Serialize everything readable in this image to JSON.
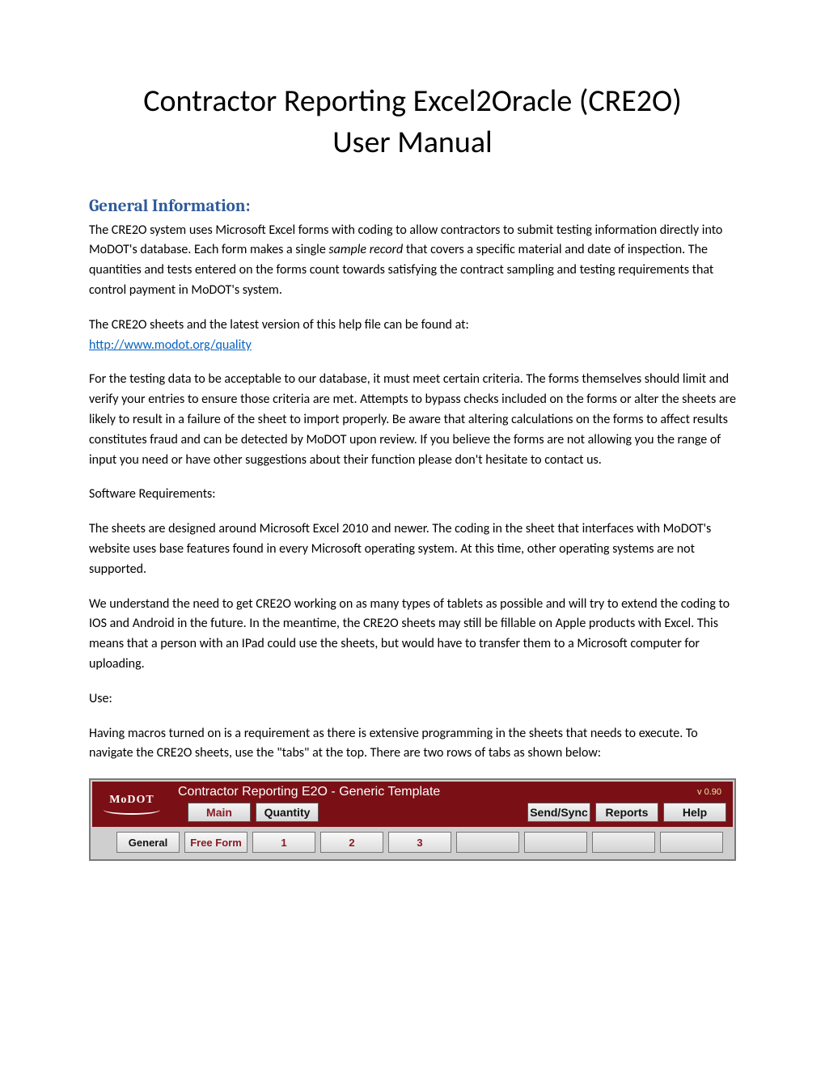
{
  "title_line1": "Contractor Reporting Excel2Oracle  (CRE2O)",
  "title_line2": "User Manual",
  "section_heading": "General Information:",
  "para1a": "The CRE2O system uses Microsoft Excel forms with coding to allow contractors to submit testing information directly into MoDOT's database.   Each form makes a single ",
  "para1_italic": "sample record",
  "para1b": " that covers a specific material and date of inspection.  The quantities and tests entered on the forms count towards satisfying the contract sampling and testing requirements that control payment in MoDOT's system.",
  "para2_intro": "The CRE2O sheets and the latest version of this help file can be found at:",
  "link_url": "http://www.modot.org/quality",
  "para3": "For the testing data to be acceptable to our database, it must meet certain criteria.  The forms themselves should limit and verify your entries to ensure those criteria are met.   Attempts to bypass checks included on the forms or alter the sheets are likely to result in a failure of the sheet to import properly.   Be aware that altering calculations on the forms to affect results constitutes fraud and can be detected by MoDOT upon review.  If you believe the forms are not allowing you the range of input you need or have other suggestions about their function please don't hesitate to contact us.",
  "para4": "Software Requirements:",
  "para5": "The sheets are designed around Microsoft Excel 2010 and newer.   The coding in the sheet that interfaces with MoDOT's website uses base features found in every Microsoft operating system.   At this time, other operating systems are not supported.",
  "para6": "We understand the need to get CRE2O working on as many types of tablets as possible and will try to extend the coding to IOS and Android in the future.  In the meantime, the CRE2O sheets may still be fillable on Apple products with Excel.  This means that a person with an IPad could use the sheets, but would have to transfer them to a Microsoft computer for uploading.",
  "para7": "Use:",
  "para8": "Having macros turned on is a requirement as there is extensive programming in the sheets that needs to execute.  To navigate the CRE2O sheets, use the \"tabs\" at the top.  There are two rows of tabs as shown below:",
  "appbar": {
    "logo": "MoDOT",
    "title": "Contractor Reporting E2O - Generic Template",
    "version": "v 0.90",
    "top_tabs": [
      "Main",
      "Quantity",
      "",
      "Send/Sync",
      "Reports",
      "Help"
    ],
    "sub_tabs": [
      "General",
      "Free Form",
      "1",
      "2",
      "3",
      "",
      "",
      "",
      ""
    ]
  }
}
